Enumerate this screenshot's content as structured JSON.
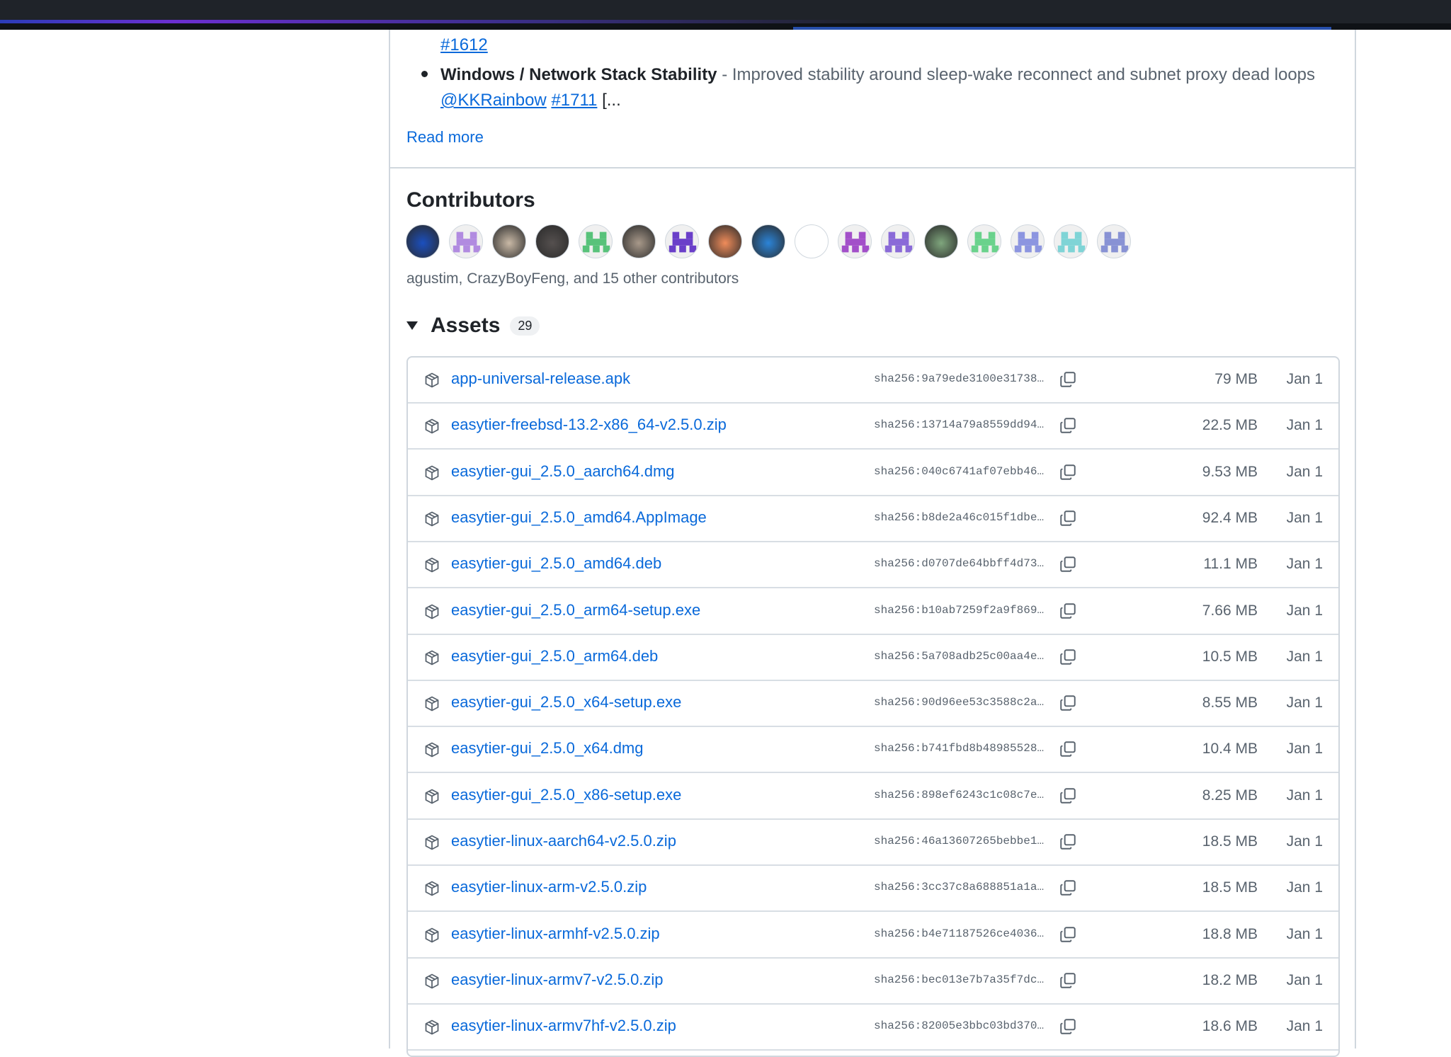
{
  "release_notes": {
    "issue_link_1612": "#1612",
    "bullet_title": "Windows / Network Stack Stability",
    "bullet_desc": " - Improved stability around sleep-wake reconnect and subnet proxy dead loops",
    "author_link": "@KKRainbow",
    "issue_link_1711": "#1711",
    "ellipsis": " [...",
    "read_more": "Read more"
  },
  "contributors": {
    "title": "Contributors",
    "summary": "agustim, CrazyBoyFeng, and 15 other contributors",
    "avatars": [
      {
        "name": "agustim",
        "color": "#1b4fbf"
      },
      {
        "name": "identicon-purple-1",
        "color": "#b18be0"
      },
      {
        "name": "CrazyBoyFeng",
        "color": "#c9b9a6"
      },
      {
        "name": "avatar-dark-cat",
        "color": "#55504f"
      },
      {
        "name": "identicon-green-1",
        "color": "#58c27a"
      },
      {
        "name": "avatar-person",
        "color": "#a8998a"
      },
      {
        "name": "identicon-purple-2",
        "color": "#6a3fc9"
      },
      {
        "name": "avatar-sunset",
        "color": "#f08c5a"
      },
      {
        "name": "avatar-cartoon-face",
        "color": "#2b84d8"
      },
      {
        "name": "avatar-blue-logo",
        "color": "#ffffff"
      },
      {
        "name": "identicon-magenta",
        "color": "#a24fc9"
      },
      {
        "name": "identicon-purple-3",
        "color": "#8a6ad8"
      },
      {
        "name": "avatar-anime",
        "color": "#7fa67d"
      },
      {
        "name": "identicon-green-2",
        "color": "#6ad28c"
      },
      {
        "name": "identicon-lavender",
        "color": "#8c95e0"
      },
      {
        "name": "identicon-teal",
        "color": "#7fd4d6"
      },
      {
        "name": "identicon-slate",
        "color": "#8892d4"
      }
    ]
  },
  "assets": {
    "title": "Assets",
    "count": "29",
    "items": [
      {
        "name": "app-universal-release.apk",
        "sha": "sha256:9a79ede3100e31738…",
        "size": "79 MB",
        "date": "Jan 1"
      },
      {
        "name": "easytier-freebsd-13.2-x86_64-v2.5.0.zip",
        "sha": "sha256:13714a79a8559dd94…",
        "size": "22.5 MB",
        "date": "Jan 1"
      },
      {
        "name": "easytier-gui_2.5.0_aarch64.dmg",
        "sha": "sha256:040c6741af07ebb46…",
        "size": "9.53 MB",
        "date": "Jan 1"
      },
      {
        "name": "easytier-gui_2.5.0_amd64.AppImage",
        "sha": "sha256:b8de2a46c015f1dbe…",
        "size": "92.4 MB",
        "date": "Jan 1"
      },
      {
        "name": "easytier-gui_2.5.0_amd64.deb",
        "sha": "sha256:d0707de64bbff4d73…",
        "size": "11.1 MB",
        "date": "Jan 1"
      },
      {
        "name": "easytier-gui_2.5.0_arm64-setup.exe",
        "sha": "sha256:b10ab7259f2a9f869…",
        "size": "7.66 MB",
        "date": "Jan 1"
      },
      {
        "name": "easytier-gui_2.5.0_arm64.deb",
        "sha": "sha256:5a708adb25c00aa4e…",
        "size": "10.5 MB",
        "date": "Jan 1"
      },
      {
        "name": "easytier-gui_2.5.0_x64-setup.exe",
        "sha": "sha256:90d96ee53c3588c2a…",
        "size": "8.55 MB",
        "date": "Jan 1"
      },
      {
        "name": "easytier-gui_2.5.0_x64.dmg",
        "sha": "sha256:b741fbd8b48985528…",
        "size": "10.4 MB",
        "date": "Jan 1"
      },
      {
        "name": "easytier-gui_2.5.0_x86-setup.exe",
        "sha": "sha256:898ef6243c1c08c7e…",
        "size": "8.25 MB",
        "date": "Jan 1"
      },
      {
        "name": "easytier-linux-aarch64-v2.5.0.zip",
        "sha": "sha256:46a13607265bebbe1…",
        "size": "18.5 MB",
        "date": "Jan 1"
      },
      {
        "name": "easytier-linux-arm-v2.5.0.zip",
        "sha": "sha256:3cc37c8a688851a1a…",
        "size": "18.5 MB",
        "date": "Jan 1"
      },
      {
        "name": "easytier-linux-armhf-v2.5.0.zip",
        "sha": "sha256:b4e71187526ce4036…",
        "size": "18.8 MB",
        "date": "Jan 1"
      },
      {
        "name": "easytier-linux-armv7-v2.5.0.zip",
        "sha": "sha256:bec013e7b7a35f7dc…",
        "size": "18.2 MB",
        "date": "Jan 1"
      },
      {
        "name": "easytier-linux-armv7hf-v2.5.0.zip",
        "sha": "sha256:82005e3bbc03bd370…",
        "size": "18.6 MB",
        "date": "Jan 1"
      }
    ]
  },
  "icons": {
    "package": "package-icon",
    "copy": "copy-icon",
    "collapse": "triangle-down-icon"
  },
  "colors": {
    "link": "#0969da",
    "muted": "#59636e",
    "border": "#d0d7de"
  }
}
